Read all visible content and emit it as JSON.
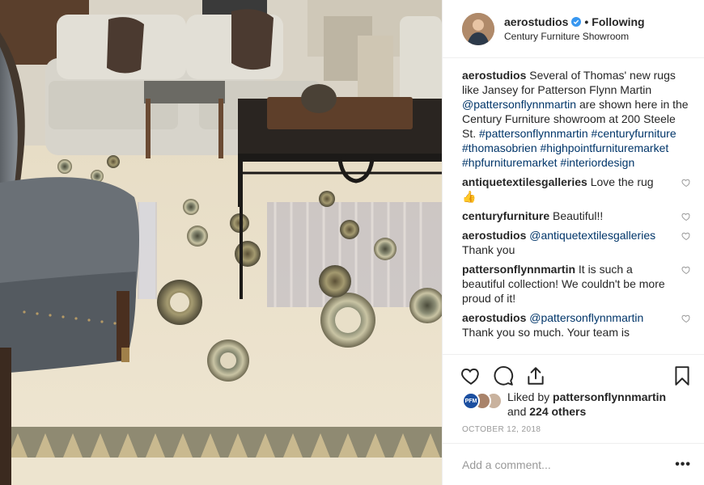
{
  "post": {
    "header": {
      "username": "aerostudios",
      "separator": "•",
      "follow_status": "Following",
      "location": "Century Furniture Showroom"
    },
    "caption": {
      "username": "aerostudios",
      "text_1": " Several of Thomas' new rugs like Jansey for Patterson Flynn Martin ",
      "mention": "@pattersonflynnmartin",
      "text_2": " are shown here in the Century Furniture showroom at 200 Steele St. ",
      "hashtags": [
        "#pattersonflynnmartin",
        "#centuryfurniture",
        "#thomasobrien",
        "#highpointfurnituremarket",
        "#hpfurnituremarket",
        "#interiordesign"
      ]
    },
    "comments": [
      {
        "username": "antiquetextilesgalleries",
        "text": " Love the rug 👍"
      },
      {
        "username": "centuryfurniture",
        "text": " Beautiful!!"
      },
      {
        "username": "aerostudios",
        "mention": "@antiquetextilesgalleries",
        "text": " Thank you"
      },
      {
        "username": "pattersonflynnmartin",
        "text": " It is such a beautiful collection! We couldn't be more proud of it!"
      },
      {
        "username": "aerostudios",
        "mention": "@pattersonflynnmartin",
        "text": " Thank you so much. Your team is"
      }
    ],
    "likes": {
      "badge": "PFM",
      "prefix": "Liked by ",
      "liker": "pattersonflynnmartin",
      "middle": "and ",
      "count_text": "224 others"
    },
    "date": "OCTOBER 12, 2018",
    "add_comment": {
      "placeholder": "Add a comment...",
      "more": "•••"
    },
    "colors": {
      "link": "#003569",
      "verified": "#3897f0",
      "border": "#efefef",
      "muted": "#999999"
    },
    "icons": [
      "verified-badge-icon",
      "heart-icon",
      "comment-icon",
      "share-icon",
      "bookmark-icon",
      "more-icon"
    ]
  }
}
